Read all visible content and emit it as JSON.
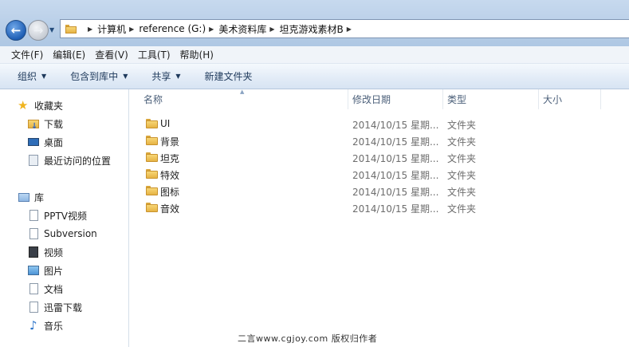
{
  "address": {
    "crumbs": [
      "计算机",
      "reference (G:)",
      "美术资料库",
      "坦克游戏素材B"
    ]
  },
  "menu": [
    "文件(F)",
    "编辑(E)",
    "查看(V)",
    "工具(T)",
    "帮助(H)"
  ],
  "commands": {
    "organize": "组织",
    "include_in_library": "包含到库中",
    "share": "共享",
    "new_folder": "新建文件夹"
  },
  "nav": {
    "favorites": "收藏夹",
    "downloads": "下载",
    "desktop": "桌面",
    "recent": "最近访问的位置",
    "libraries": "库",
    "lib_items": [
      "PPTV视频",
      "Subversion",
      "视频",
      "图片",
      "文档",
      "迅雷下载",
      "音乐"
    ]
  },
  "columns": {
    "name": "名称",
    "date": "修改日期",
    "type": "类型",
    "size": "大小"
  },
  "files": [
    {
      "name": "UI",
      "date": "2014/10/15 星期...",
      "type": "文件夹"
    },
    {
      "name": "背景",
      "date": "2014/10/15 星期...",
      "type": "文件夹"
    },
    {
      "name": "坦克",
      "date": "2014/10/15 星期...",
      "type": "文件夹"
    },
    {
      "name": "特效",
      "date": "2014/10/15 星期...",
      "type": "文件夹"
    },
    {
      "name": "图标",
      "date": "2014/10/15 星期...",
      "type": "文件夹"
    },
    {
      "name": "音效",
      "date": "2014/10/15 星期...",
      "type": "文件夹"
    }
  ],
  "watermark": "二言www.cgjoy.com 版权归作者",
  "colors": {
    "title_gradient_top": "#c7d9ee",
    "command_text": "#1e395b",
    "folder_yellow": "#e6b445"
  }
}
